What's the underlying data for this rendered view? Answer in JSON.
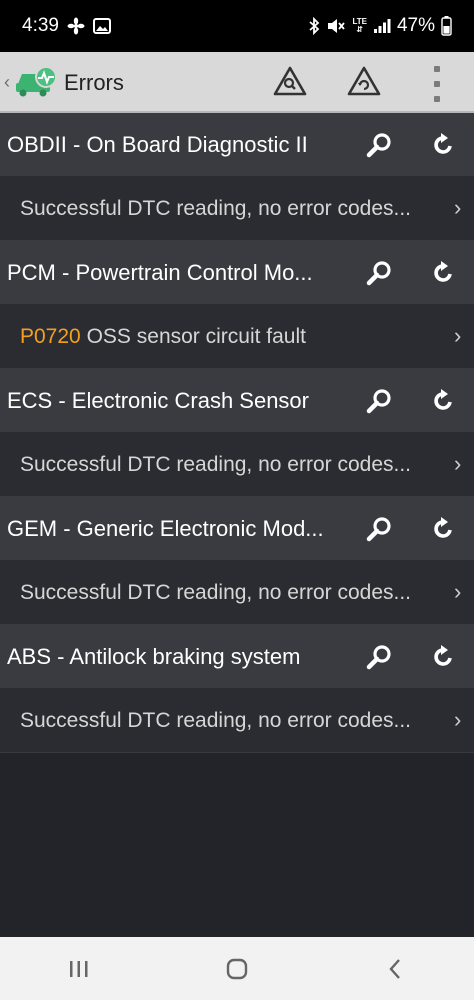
{
  "status_bar": {
    "time": "4:39",
    "lte": "LTE",
    "battery": "47%"
  },
  "app_bar": {
    "title": "Errors",
    "back_glyph": "‹",
    "icons": [
      "warning-search-icon",
      "warning-refresh-icon",
      "overflow-menu-icon"
    ]
  },
  "modules": [
    {
      "name": "OBDII - On Board Diagnostic II",
      "result_code": "",
      "result": "Successful DTC reading, no error codes..."
    },
    {
      "name": "PCM - Powertrain Control Mo...",
      "result_code": "P0720",
      "result": "OSS sensor circuit fault"
    },
    {
      "name": "ECS - Electronic Crash Sensor",
      "result_code": "",
      "result": "Successful DTC reading, no error codes..."
    },
    {
      "name": "GEM - Generic Electronic Mod...",
      "result_code": "",
      "result": "Successful DTC reading, no error codes..."
    },
    {
      "name": "ABS - Antilock braking system",
      "result_code": "",
      "result": "Successful DTC reading, no error codes..."
    }
  ],
  "colors": {
    "code": "#f2a01d",
    "module_row": "#3a3b41",
    "result_row": "#2b2c32",
    "logo_green": "#3cb371"
  },
  "nav_bar": {
    "icons": [
      "recent-apps-icon",
      "home-icon",
      "back-icon"
    ]
  }
}
